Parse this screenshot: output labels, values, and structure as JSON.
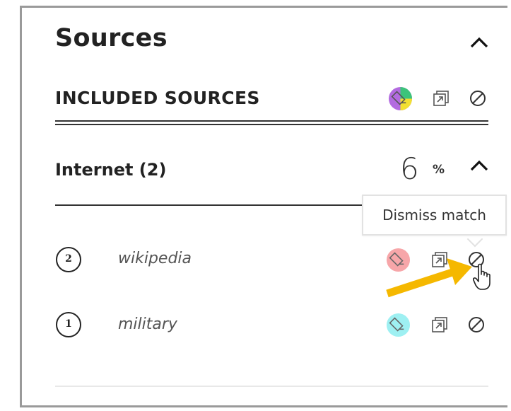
{
  "panel": {
    "title": "Sources"
  },
  "included": {
    "label": "INCLUDED SOURCES",
    "highlight_colors": [
      "#b36be0",
      "#3cc47a",
      "#f2e032"
    ]
  },
  "group": {
    "label": "Internet (2)",
    "percent": "6",
    "percent_sign": "%"
  },
  "tooltip": {
    "text": "Dismiss match"
  },
  "sources": [
    {
      "number": "2",
      "name": "wikipedia",
      "highlight_color": "#f7a6a9"
    },
    {
      "number": "1",
      "name": "military",
      "highlight_color": "#9ef0f2"
    }
  ],
  "annotation": {
    "arrow_color": "#f5b800"
  }
}
